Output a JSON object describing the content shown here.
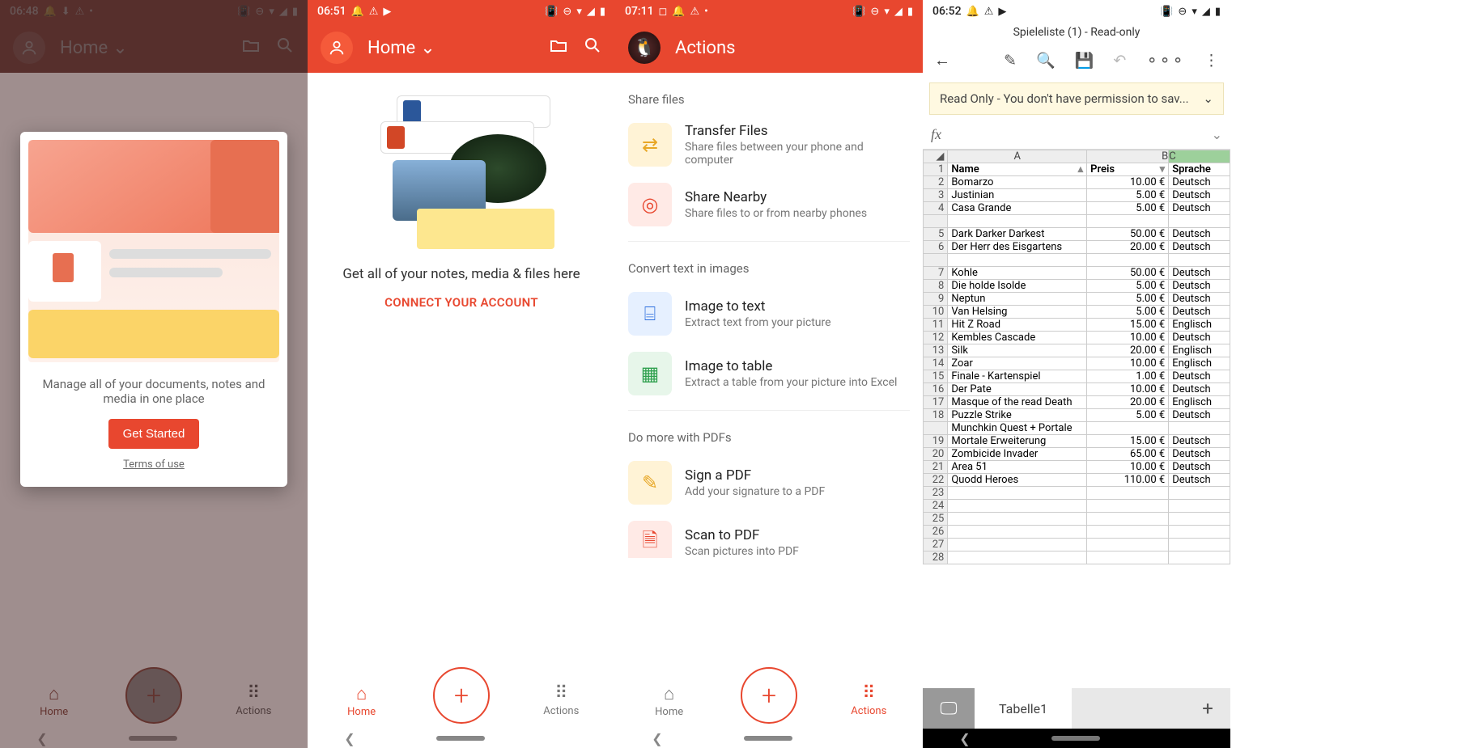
{
  "screen1": {
    "time": "06:48",
    "header_title": "Home",
    "modal_text": "Manage all of your documents, notes and media in one place",
    "modal_btn": "Get Started",
    "modal_link": "Terms of use",
    "nav_home": "Home",
    "nav_actions": "Actions"
  },
  "screen2": {
    "time": "06:51",
    "header_title": "Home",
    "body_text": "Get all of your notes, media & files here",
    "connect_link": "CONNECT YOUR ACCOUNT",
    "nav_home": "Home",
    "nav_actions": "Actions"
  },
  "screen3": {
    "time": "07:11",
    "header_title": "Actions",
    "section_share": "Share files",
    "section_convert": "Convert text in images",
    "section_pdf": "Do more with PDFs",
    "actions": {
      "transfer_t": "Transfer Files",
      "transfer_d": "Share files between your phone and computer",
      "nearby_t": "Share Nearby",
      "nearby_d": "Share files to or from nearby phones",
      "imgtext_t": "Image to text",
      "imgtext_d": "Extract text from your picture",
      "imgtable_t": "Image to table",
      "imgtable_d": "Extract a table from your picture into Excel",
      "sign_t": "Sign a PDF",
      "sign_d": "Add your signature to a PDF",
      "scan_t": "Scan to PDF",
      "scan_d": "Scan pictures into PDF"
    },
    "nav_home": "Home",
    "nav_actions": "Actions"
  },
  "screen4": {
    "time": "06:52",
    "doc_title": "Spieleliste (1) - Read-only",
    "banner": "Read Only - You don't have permission to sav...",
    "sheet_tab": "Tabelle1",
    "headers": {
      "a": "A",
      "b": "B",
      "c": "C"
    },
    "row1": {
      "a": "Name",
      "b": "Preis",
      "c": "Sprache"
    },
    "rows": [
      {
        "n": 2,
        "a": "Bomarzo",
        "b": "10.00 €",
        "c": "Deutsch"
      },
      {
        "n": 3,
        "a": "Justinian",
        "b": "5.00 €",
        "c": "Deutsch"
      },
      {
        "n": 4,
        "a": "Casa Grande",
        "b": "5.00 €",
        "c": "Deutsch"
      },
      {
        "n": "",
        "a": "",
        "b": "",
        "c": ""
      },
      {
        "n": 5,
        "a": "Dark Darker Darkest",
        "b": "50.00 €",
        "c": "Deutsch"
      },
      {
        "n": 6,
        "a": "Der Herr des Eisgartens",
        "b": "20.00 €",
        "c": "Deutsch"
      },
      {
        "n": "",
        "a": "",
        "b": "",
        "c": ""
      },
      {
        "n": 7,
        "a": "Kohle",
        "b": "50.00 €",
        "c": "Deutsch"
      },
      {
        "n": 8,
        "a": "Die holde Isolde",
        "b": "5.00 €",
        "c": "Deutsch"
      },
      {
        "n": 9,
        "a": "Neptun",
        "b": "5.00 €",
        "c": "Deutsch"
      },
      {
        "n": 10,
        "a": "Van Helsing",
        "b": "5.00 €",
        "c": "Deutsch"
      },
      {
        "n": 11,
        "a": "Hit Z Road",
        "b": "15.00 €",
        "c": "Englisch"
      },
      {
        "n": 12,
        "a": "Kembles Cascade",
        "b": "10.00 €",
        "c": "Deutsch"
      },
      {
        "n": 13,
        "a": "Silk",
        "b": "20.00 €",
        "c": "Englisch"
      },
      {
        "n": 14,
        "a": "Zoar",
        "b": "10.00 €",
        "c": "Englisch"
      },
      {
        "n": 15,
        "a": "Finale - Kartenspiel",
        "b": "1.00 €",
        "c": "Deutsch"
      },
      {
        "n": 16,
        "a": "Der Pate",
        "b": "10.00 €",
        "c": "Deutsch"
      },
      {
        "n": 17,
        "a": "Masque of the read Death",
        "b": "20.00 €",
        "c": "Englisch"
      },
      {
        "n": 18,
        "a": "Puzzle Strike",
        "b": "5.00 €",
        "c": "Deutsch"
      },
      {
        "n": "",
        "a": "Munchkin Quest + Portale",
        "b": "",
        "c": ""
      },
      {
        "n": 19,
        "a": "Mortale Erweiterung",
        "b": "15.00 €",
        "c": "Deutsch"
      },
      {
        "n": 20,
        "a": "Zombicide Invader",
        "b": "65.00 €",
        "c": "Deutsch"
      },
      {
        "n": 21,
        "a": "Area 51",
        "b": "10.00 €",
        "c": "Deutsch"
      },
      {
        "n": 22,
        "a": "Quodd Heroes",
        "b": "110.00 €",
        "c": "Deutsch"
      },
      {
        "n": 23,
        "a": "",
        "b": "",
        "c": ""
      },
      {
        "n": 24,
        "a": "",
        "b": "",
        "c": ""
      },
      {
        "n": 25,
        "a": "",
        "b": "",
        "c": ""
      },
      {
        "n": 26,
        "a": "",
        "b": "",
        "c": ""
      },
      {
        "n": 27,
        "a": "",
        "b": "",
        "c": ""
      },
      {
        "n": 28,
        "a": "",
        "b": "",
        "c": ""
      }
    ]
  }
}
